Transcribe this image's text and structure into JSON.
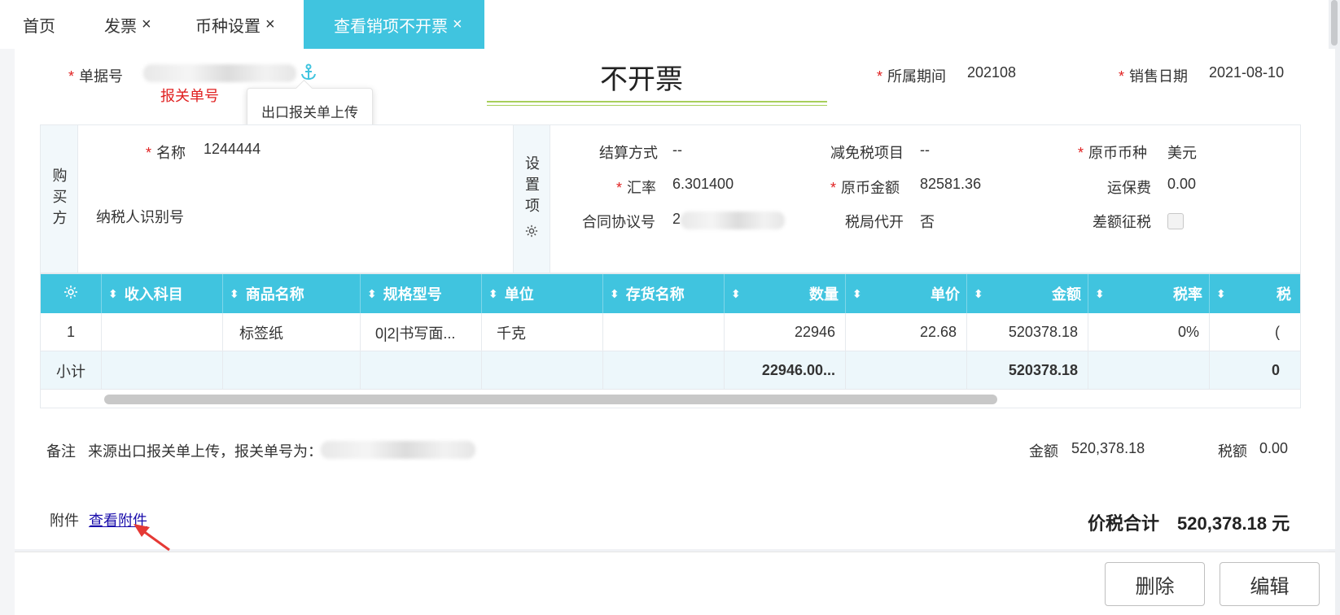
{
  "tabs": [
    {
      "label": "首页",
      "closable": false
    },
    {
      "label": "发票",
      "closable": true
    },
    {
      "label": "币种设置",
      "closable": true
    },
    {
      "label": "查看销项不开票",
      "closable": true,
      "active": true
    }
  ],
  "close_glyph": "×",
  "header": {
    "doc_no_label": "单据号",
    "doc_no_hint": "报关单号",
    "anchor_tooltip": "出口报关单上传",
    "title": "不开票",
    "period_label": "所属期间",
    "period_value": "202108",
    "sale_date_label": "销售日期",
    "sale_date_value": "2021-08-10"
  },
  "buyer": {
    "section_label": "购买方",
    "name_label": "名称",
    "name_value": "1244444",
    "taxid_label": "纳税人识别号"
  },
  "settings": {
    "section_label": "设置项",
    "settle_label": "结算方式",
    "settle_value": "--",
    "exempt_label": "减免税项目",
    "exempt_value": "--",
    "orig_currency_label": "原币币种",
    "orig_currency_value": "美元",
    "rate_label": "汇率",
    "rate_value": "6.301400",
    "orig_amount_label": "原币金额",
    "orig_amount_value": "82581.36",
    "freight_label": "运保费",
    "freight_value": "0.00",
    "contract_label": "合同协议号",
    "contract_value_visible": "2",
    "tax_bureau_label": "税局代开",
    "tax_bureau_value": "否",
    "diff_tax_label": "差额征税",
    "diff_tax_checked": false
  },
  "table": {
    "columns": [
      "收入科目",
      "商品名称",
      "规格型号",
      "单位",
      "存货名称",
      "数量",
      "单价",
      "金额",
      "税率",
      "税"
    ],
    "rows": [
      {
        "index": "1",
        "income": "",
        "product": "标签纸",
        "spec": "0|2|书写面...",
        "unit": "千克",
        "stock": "",
        "qty": "22946",
        "price": "22.68",
        "amount": "520378.18",
        "tax_rate": "0%",
        "tax": "("
      }
    ],
    "subtotal": {
      "label": "小计",
      "qty": "22946.00...",
      "amount": "520378.18",
      "tax": "0"
    }
  },
  "remarks": {
    "label": "备注",
    "text": "来源出口报关单上传，报关单号为：",
    "amount_label": "金额",
    "amount_value": "520,378.18",
    "tax_label": "税额",
    "tax_value": "0.00"
  },
  "attachment": {
    "label": "附件",
    "link": "查看附件"
  },
  "total": {
    "label": "价税合计",
    "value": "520,378.18 元"
  },
  "footer": {
    "delete_label": "删除",
    "edit_label": "编辑"
  },
  "colors": {
    "accent": "#40c4df",
    "required": "#e02020",
    "hint_red": "#e02020",
    "title_underline": "#a7cf5a",
    "arrow": "#e53935"
  },
  "icons": [
    "anchor-icon",
    "gear-icon",
    "sort-icon",
    "close-icon",
    "arrow-icon"
  ]
}
